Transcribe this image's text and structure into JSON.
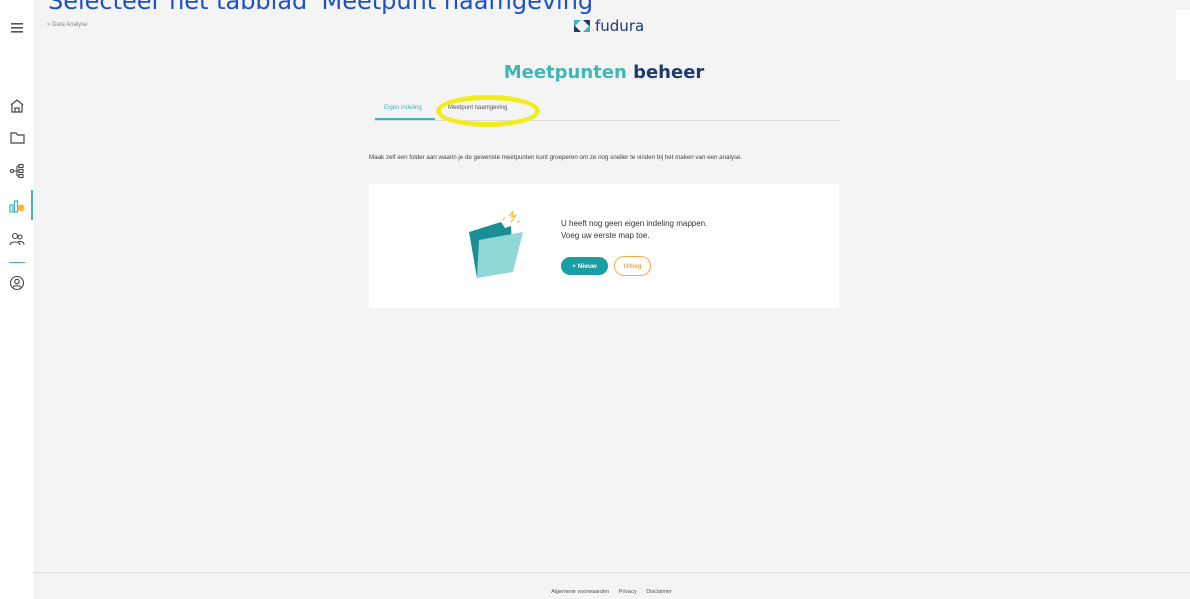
{
  "instruction": "Selecteer het tabblad 'Meetpunt naamgeving'",
  "topbar": {
    "back_label": "< Data Analyse",
    "logo_text": "fudura"
  },
  "sidebar": {
    "icons": [
      "menu-icon",
      "home-icon",
      "folder-icon",
      "hierarchy-icon",
      "analysis-icon",
      "users-icon",
      "account-icon"
    ],
    "accent": "#3fb6b7"
  },
  "page": {
    "title_part1": "Meetpunten",
    "title_part2": "beheer",
    "tabs": [
      {
        "label": "Eigen indeling",
        "active": true
      },
      {
        "label": "Meetpunt naamgeving",
        "active": false
      }
    ],
    "description": "Maak zelf een folder aan waarin je de gewenste meetpunten kunt groeperen om ze nog sneller te vinden bij het maken van een analyse."
  },
  "empty_state": {
    "line1": "U heeft nog geen eigen indeling mappen.",
    "line2": "Voeg uw eerste map toe.",
    "new_button": "+ Nieuw",
    "help_button": "Uitleg"
  },
  "footer": {
    "links": [
      "Algemene voorwaarden",
      "Privacy",
      "Disclaimer"
    ]
  },
  "colors": {
    "teal": "#3fb6b7",
    "navy": "#1f3b6e",
    "orange": "#f3a94e",
    "highlight": "#f2ec1a"
  }
}
